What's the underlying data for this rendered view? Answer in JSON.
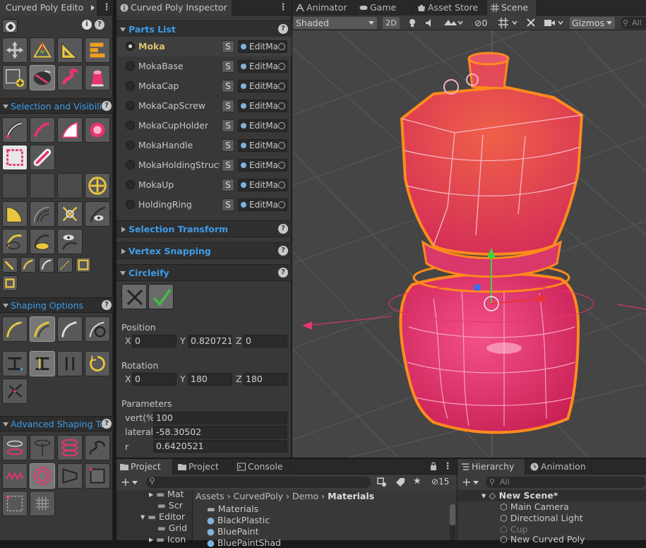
{
  "tool_panel": {
    "tab_title": "Curved Poly Edito",
    "sections": {
      "selection": "Selection and Visibilit",
      "shaping": "Shaping Options",
      "advanced": "Advanced Shaping To"
    }
  },
  "inspector": {
    "tab_title": "Curved Poly Inspector",
    "parts_list_title": "Parts List",
    "parts": [
      {
        "name": "Moka",
        "selected": true,
        "s": "S",
        "field": "EditMa"
      },
      {
        "name": "MokaBase",
        "selected": false,
        "s": "S",
        "field": "EditMa"
      },
      {
        "name": "MokaCap",
        "selected": false,
        "s": "S",
        "field": "EditMa"
      },
      {
        "name": "MokaCapScrew",
        "selected": false,
        "s": "S",
        "field": "EditMa"
      },
      {
        "name": "MokaCupHolder",
        "selected": false,
        "s": "S",
        "field": "EditMa"
      },
      {
        "name": "MokaHandle",
        "selected": false,
        "s": "S",
        "field": "EditMa"
      },
      {
        "name": "MokaHoldingStructu",
        "selected": false,
        "s": "S",
        "field": "EditMa"
      },
      {
        "name": "MokaUp",
        "selected": false,
        "s": "S",
        "field": "EditMa"
      },
      {
        "name": "HoldingRing",
        "selected": false,
        "s": "S",
        "field": "EditMa"
      }
    ],
    "selection_transform": "Selection Transform",
    "vertex_snapping": "Vertex Snapping",
    "circleify": "Circleify",
    "position_label": "Position",
    "position": {
      "x_label": "X",
      "x": "0",
      "y_label": "Y",
      "y": "0.820721",
      "z_label": "Z",
      "z": "0"
    },
    "rotation_label": "Rotation",
    "rotation": {
      "x_label": "X",
      "x": "0",
      "y_label": "Y",
      "y": "180",
      "z_label": "Z",
      "z": "180"
    },
    "parameters_label": "Parameters",
    "params": [
      {
        "label": "vert(%)",
        "value": "100"
      },
      {
        "label": "lateral",
        "value": "-58.30502"
      },
      {
        "label": "r",
        "value": "0.6420521"
      }
    ]
  },
  "scene": {
    "tabs": [
      "Animator",
      "Game",
      "Asset Store",
      "Scene"
    ],
    "shading": "Shaded",
    "mode_2d": "2D",
    "fx_count": "0",
    "gizmos": "Gizmos",
    "search_placeholder": "All"
  },
  "project": {
    "tabs": [
      "Project",
      "Project",
      "Console"
    ],
    "hidden_count": "15",
    "breadcrumb": [
      "Assets",
      "CurvedPoly",
      "Demo",
      "Materials"
    ],
    "tree": [
      "Mat",
      "Scr",
      "Editor",
      "Grid",
      "Icon"
    ],
    "files": [
      "Materials",
      "BlackPlastic",
      "BluePaint",
      "BluePaintShad"
    ]
  },
  "hierarchy": {
    "tabs": [
      "Hierarchy",
      "Animation"
    ],
    "search_placeholder": "All",
    "scene_name": "New Scene*",
    "items": [
      "Main Camera",
      "Directional Light",
      "Cup",
      "New Curved Poly"
    ]
  },
  "colors": {
    "accent_blue": "#3e9ce8",
    "mesh_pink": "#e8356e",
    "mesh_orange": "#ff8a1e"
  }
}
